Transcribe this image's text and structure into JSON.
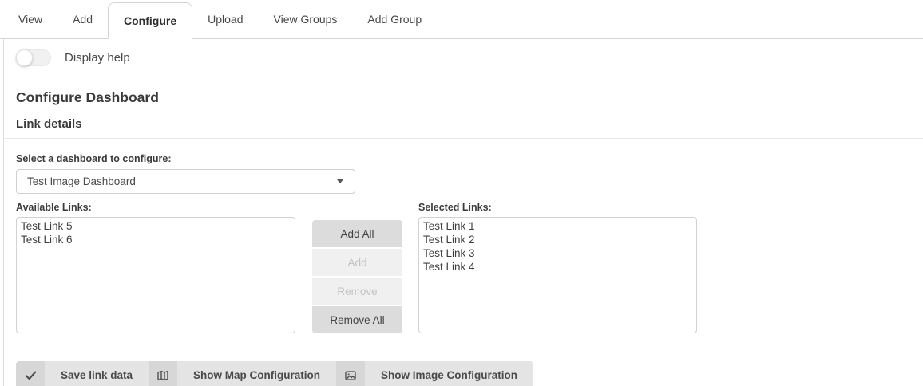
{
  "tabs": [
    {
      "label": "View",
      "active": false
    },
    {
      "label": "Add",
      "active": false
    },
    {
      "label": "Configure",
      "active": true
    },
    {
      "label": "Upload",
      "active": false
    },
    {
      "label": "View Groups",
      "active": false
    },
    {
      "label": "Add Group",
      "active": false
    }
  ],
  "help_toggle": {
    "label": "Display help",
    "state": "off"
  },
  "page": {
    "title": "Configure Dashboard",
    "section_title": "Link details"
  },
  "form": {
    "dashboard_select": {
      "label": "Select a dashboard to configure:",
      "value": "Test Image Dashboard"
    },
    "available": {
      "label": "Available Links:",
      "items": [
        "Test Link 5",
        "Test Link 6"
      ]
    },
    "selected": {
      "label": "Selected Links:",
      "items": [
        "Test Link 1",
        "Test Link 2",
        "Test Link 3",
        "Test Link 4"
      ]
    },
    "transfer_buttons": [
      {
        "label": "Add All",
        "enabled": true
      },
      {
        "label": "Add",
        "enabled": false
      },
      {
        "label": "Remove",
        "enabled": false
      },
      {
        "label": "Remove All",
        "enabled": true
      }
    ]
  },
  "actions": [
    {
      "label": "Save link data",
      "icon": "check-icon"
    },
    {
      "label": "Show Map Configuration",
      "icon": "map-icon"
    },
    {
      "label": "Show Image Configuration",
      "icon": "image-icon"
    }
  ],
  "colors": {
    "accent_border": "#d5d5d5",
    "enabled_button_bg": "#dcdcdc",
    "disabled_button_bg": "#f0f0f0",
    "action_icon_bg": "#d7d7d7",
    "action_label_bg": "#e4e4e4",
    "text": "#464646"
  }
}
